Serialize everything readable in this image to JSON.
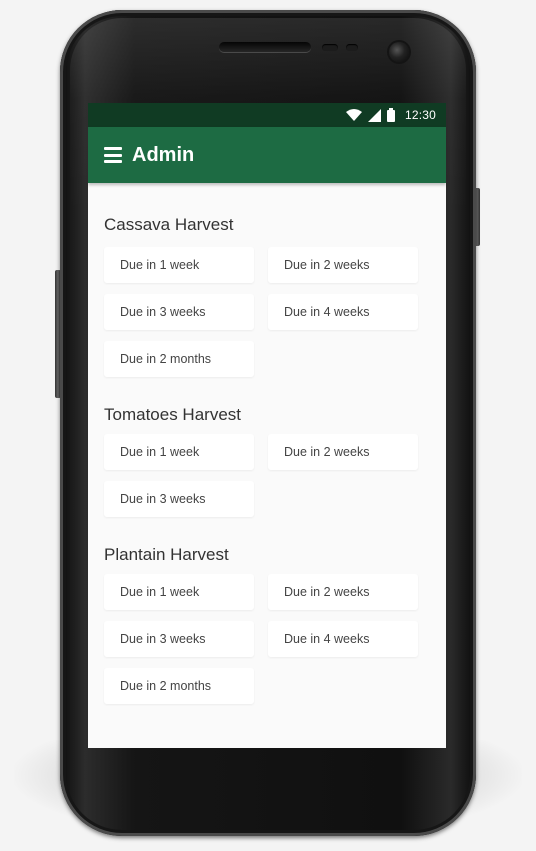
{
  "status_bar": {
    "time": "12:30",
    "icons": [
      "wifi-icon",
      "cell-signal-icon",
      "battery-icon"
    ]
  },
  "app_bar": {
    "menu_icon": "hamburger-menu-icon",
    "title": "Admin",
    "color": "#1d6b43",
    "status_color": "#103b23"
  },
  "sections": [
    {
      "title": "Cassava Harvest",
      "items": [
        {
          "label": "Due in 1 week"
        },
        {
          "label": "Due in 2 weeks"
        },
        {
          "label": "Due in 3 weeks"
        },
        {
          "label": "Due in 4 weeks"
        },
        {
          "label": "Due in 2 months"
        }
      ]
    },
    {
      "title": "Tomatoes Harvest",
      "items": [
        {
          "label": "Due in 1 week"
        },
        {
          "label": "Due in 2 weeks"
        },
        {
          "label": "Due in 3 weeks"
        }
      ]
    },
    {
      "title": "Plantain Harvest",
      "items": [
        {
          "label": "Due in 1 week"
        },
        {
          "label": "Due in 2 weeks"
        },
        {
          "label": "Due in 3 weeks"
        },
        {
          "label": "Due in 4 weeks"
        },
        {
          "label": "Due in 2 months"
        }
      ]
    }
  ]
}
